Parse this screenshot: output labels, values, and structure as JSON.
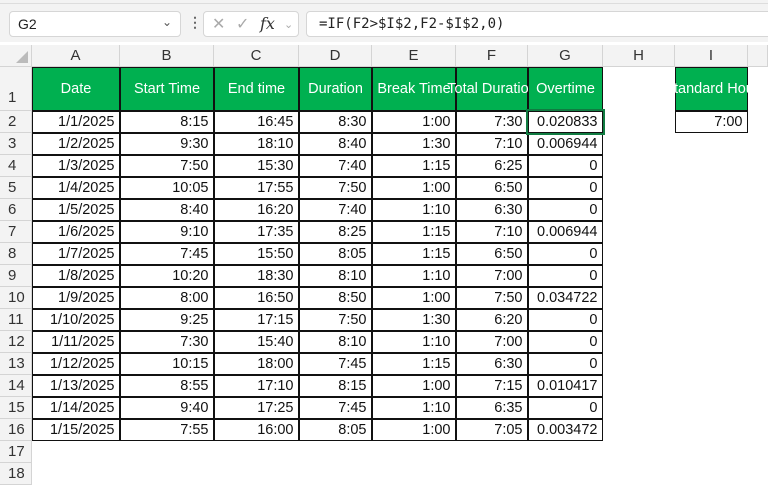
{
  "name_box": "G2",
  "formula": "=IF(F2>$I$2,F2-$I$2,0)",
  "columns": [
    "A",
    "B",
    "C",
    "D",
    "E",
    "F",
    "G",
    "H",
    "I"
  ],
  "row_numbers": [
    "1",
    "2",
    "3",
    "4",
    "5",
    "6",
    "7",
    "8",
    "9",
    "10",
    "11",
    "12",
    "13",
    "14",
    "15",
    "16",
    "17",
    "18"
  ],
  "headers": [
    "Date",
    "Start Time",
    "End time",
    "Duration",
    "Break Time",
    "Total Duration",
    "Overtime"
  ],
  "standard": {
    "label": "Standard Hour",
    "value": "7:00"
  },
  "rows": [
    [
      "1/1/2025",
      "8:15",
      "16:45",
      "8:30",
      "1:00",
      "7:30",
      "0.020833"
    ],
    [
      "1/2/2025",
      "9:30",
      "18:10",
      "8:40",
      "1:30",
      "7:10",
      "0.006944"
    ],
    [
      "1/3/2025",
      "7:50",
      "15:30",
      "7:40",
      "1:15",
      "6:25",
      "0"
    ],
    [
      "1/4/2025",
      "10:05",
      "17:55",
      "7:50",
      "1:00",
      "6:50",
      "0"
    ],
    [
      "1/5/2025",
      "8:40",
      "16:20",
      "7:40",
      "1:10",
      "6:30",
      "0"
    ],
    [
      "1/6/2025",
      "9:10",
      "17:35",
      "8:25",
      "1:15",
      "7:10",
      "0.006944"
    ],
    [
      "1/7/2025",
      "7:45",
      "15:50",
      "8:05",
      "1:15",
      "6:50",
      "0"
    ],
    [
      "1/8/2025",
      "10:20",
      "18:30",
      "8:10",
      "1:10",
      "7:00",
      "0"
    ],
    [
      "1/9/2025",
      "8:00",
      "16:50",
      "8:50",
      "1:00",
      "7:50",
      "0.034722"
    ],
    [
      "1/10/2025",
      "9:25",
      "17:15",
      "7:50",
      "1:30",
      "6:20",
      "0"
    ],
    [
      "1/11/2025",
      "7:30",
      "15:40",
      "8:10",
      "1:10",
      "7:00",
      "0"
    ],
    [
      "1/12/2025",
      "10:15",
      "18:00",
      "7:45",
      "1:15",
      "6:30",
      "0"
    ],
    [
      "1/13/2025",
      "8:55",
      "17:10",
      "8:15",
      "1:00",
      "7:15",
      "0.010417"
    ],
    [
      "1/14/2025",
      "9:40",
      "17:25",
      "7:45",
      "1:10",
      "6:35",
      "0"
    ],
    [
      "1/15/2025",
      "7:55",
      "16:00",
      "8:05",
      "1:00",
      "7:05",
      "0.003472"
    ]
  ]
}
